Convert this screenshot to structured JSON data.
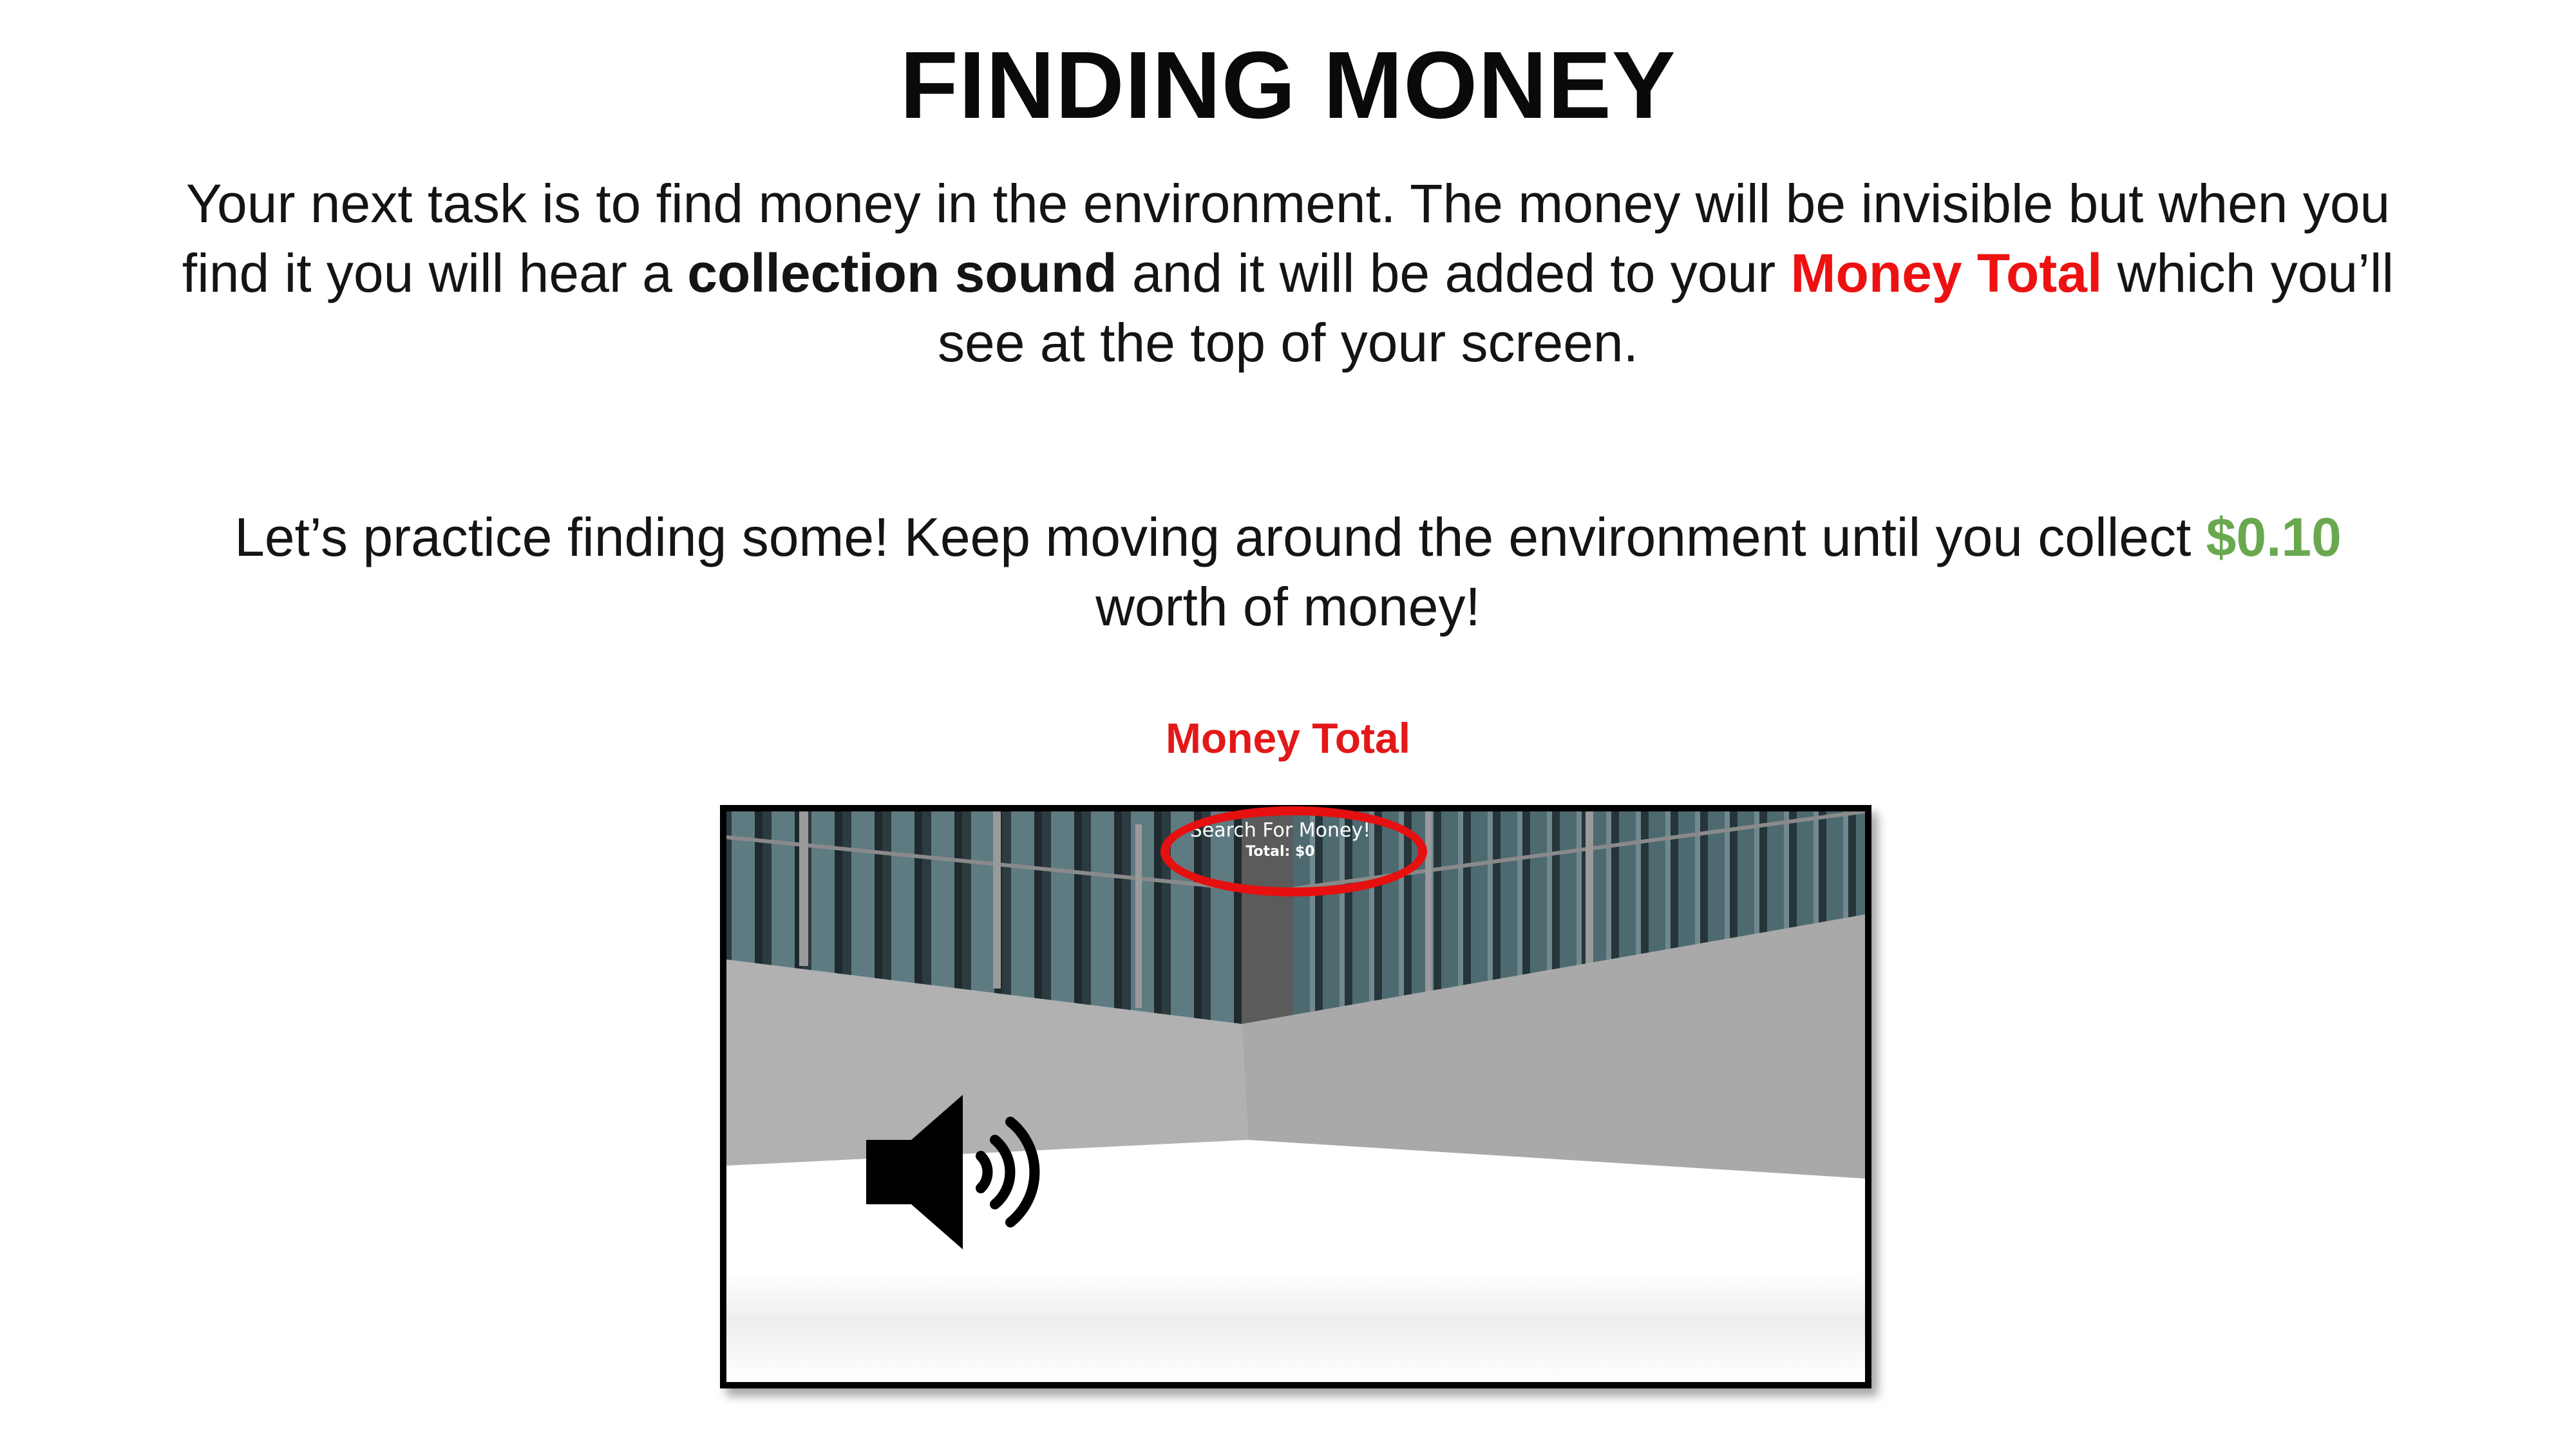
{
  "title": "FINDING MONEY",
  "paragraph1": {
    "text_a": "Your next task is to find money in the environment. The money will be invisible but when you find it you will hear a ",
    "bold": "collection sound",
    "text_b": " and it will be added to your ",
    "highlight": "Money Total",
    "text_c": " which you’ll see at the top of your screen."
  },
  "paragraph2": {
    "text_a": "Let’s practice finding some! Keep moving around the environment until you collect ",
    "amount": "$0.10",
    "text_b": " worth of money!"
  },
  "money_total_label": "Money Total",
  "game": {
    "hud_title": "Search For Money!",
    "hud_total": "Total: $0"
  },
  "icons": {
    "speaker": "speaker-volume-icon"
  },
  "colors": {
    "highlight_red": "#ee1111",
    "amount_green": "#6aa84f",
    "ring_red": "#e61010"
  }
}
